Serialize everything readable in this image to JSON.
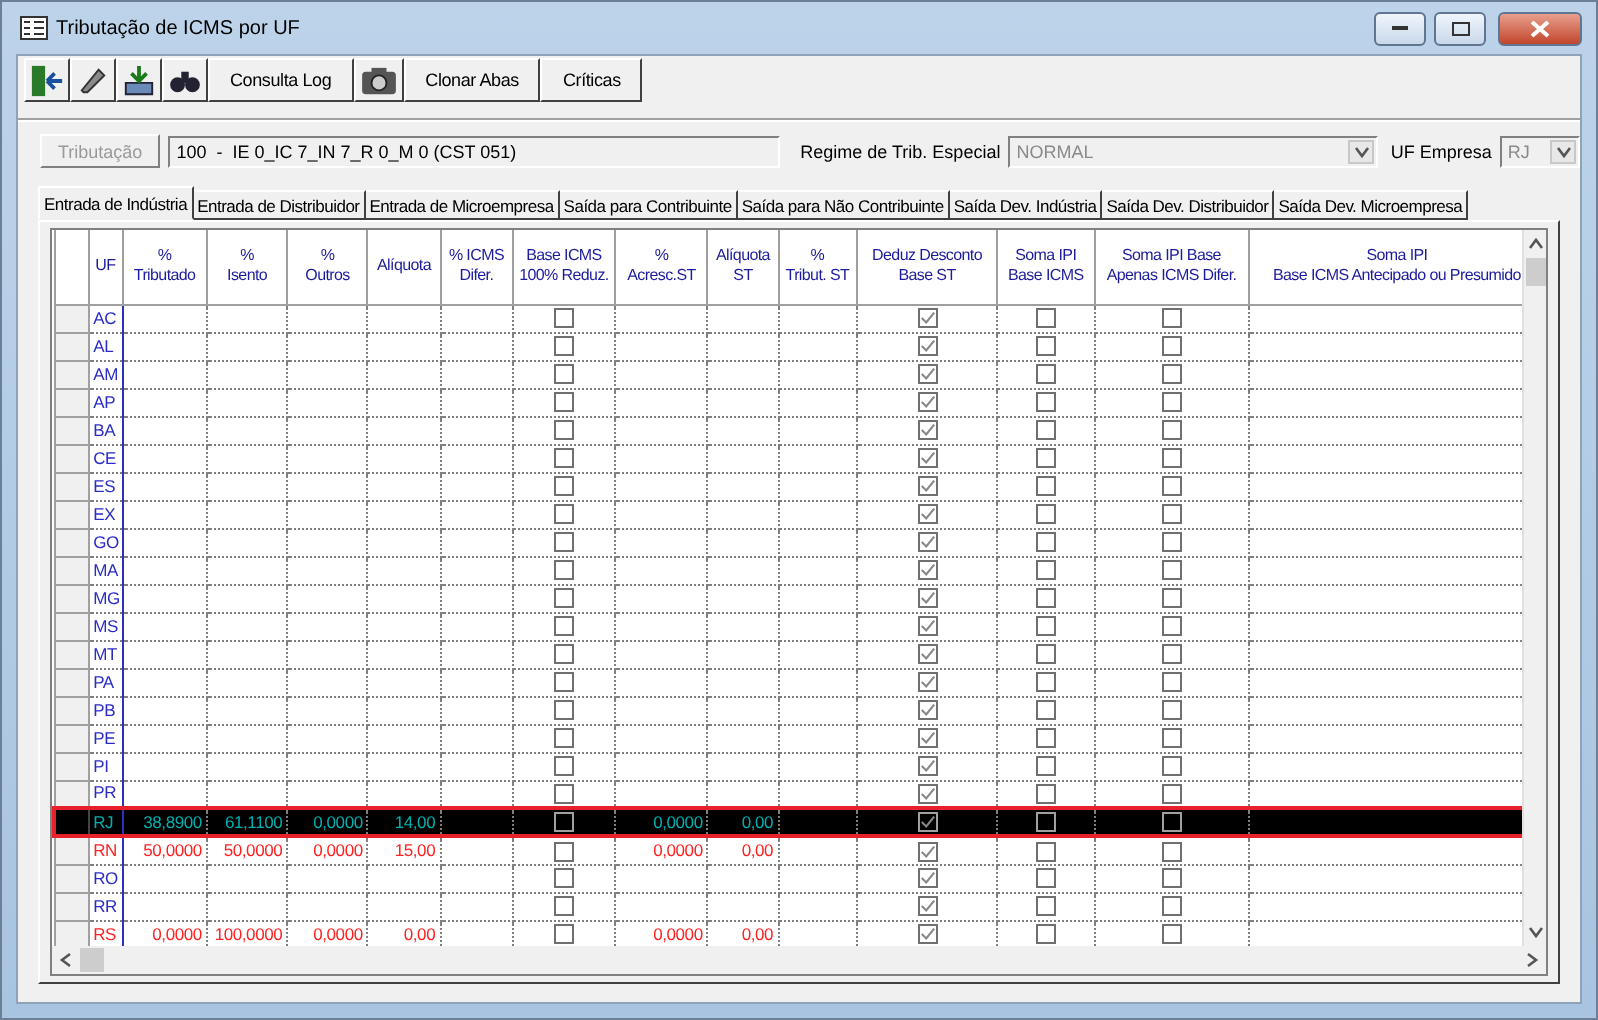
{
  "window": {
    "title": "Tributação de ICMS por UF"
  },
  "toolbar": {
    "buttons": [
      {
        "kind": "exit"
      },
      {
        "kind": "pencil"
      },
      {
        "kind": "import"
      },
      {
        "kind": "binoculars"
      },
      {
        "kind": "text",
        "label": "Consulta Log"
      },
      {
        "kind": "camera"
      },
      {
        "kind": "text",
        "label": "Clonar Abas"
      },
      {
        "kind": "text",
        "label": "Críticas"
      }
    ]
  },
  "tributacao": {
    "button": "Tributação",
    "disabled": true,
    "value": "100  -  IE 0_IC 7_IN 7_R 0_M 0 (CST 051)"
  },
  "regime": {
    "label": "Regime de Trib. Especial",
    "value": "NORMAL"
  },
  "uf_empresa": {
    "label": "UF Empresa",
    "value": "RJ"
  },
  "tabs": [
    {
      "label": "Entrada de Indústria",
      "selected": true
    },
    {
      "label": "Entrada de Distribuidor",
      "selected": false
    },
    {
      "label": "Entrada de Microempresa",
      "selected": false
    },
    {
      "label": "Saída para Contribuinte",
      "selected": false
    },
    {
      "label": "Saída para Não Contribuinte",
      "selected": false
    },
    {
      "label": "Saída Dev. Indústria",
      "selected": false
    },
    {
      "label": "Saída Dev. Distribuidor",
      "selected": false
    },
    {
      "label": "Saída Dev. Microempresa",
      "selected": false
    }
  ],
  "table": {
    "columns": [
      {
        "kind": "uf",
        "label": "UF"
      },
      {
        "kind": "num",
        "label": "%\nTributado"
      },
      {
        "kind": "num",
        "label": "%\nIsento"
      },
      {
        "kind": "num",
        "label": "%\nOutros"
      },
      {
        "kind": "num",
        "label": "Alíquota"
      },
      {
        "kind": "num",
        "label": "% ICMS\nDifer."
      },
      {
        "kind": "check",
        "label": "Base ICMS\n100% Reduz."
      },
      {
        "kind": "num",
        "label": "%\nAcresc.ST"
      },
      {
        "kind": "num",
        "label": "Alíquota\nST"
      },
      {
        "kind": "num",
        "label": "%\nTribut. ST"
      },
      {
        "kind": "check",
        "label": "Deduz Desconto\nBase ST"
      },
      {
        "kind": "check",
        "label": "Soma IPI\nBase ICMS"
      },
      {
        "kind": "check",
        "label": "Soma IPI Base\nApenas ICMS Difer."
      },
      {
        "kind": "num",
        "label": "Soma IPI\nBase ICMS Antecipado ou Presumido"
      }
    ],
    "rows": [
      {
        "color": "#2b2bc8",
        "selected": false,
        "cells": [
          "AC",
          "",
          "",
          "",
          "",
          "",
          false,
          "",
          "",
          "",
          true,
          false,
          false,
          ""
        ]
      },
      {
        "color": "#2b2bc8",
        "selected": false,
        "cells": [
          "AL",
          "",
          "",
          "",
          "",
          "",
          false,
          "",
          "",
          "",
          true,
          false,
          false,
          ""
        ]
      },
      {
        "color": "#2b2bc8",
        "selected": false,
        "cells": [
          "AM",
          "",
          "",
          "",
          "",
          "",
          false,
          "",
          "",
          "",
          true,
          false,
          false,
          ""
        ]
      },
      {
        "color": "#2b2bc8",
        "selected": false,
        "cells": [
          "AP",
          "",
          "",
          "",
          "",
          "",
          false,
          "",
          "",
          "",
          true,
          false,
          false,
          ""
        ]
      },
      {
        "color": "#2b2bc8",
        "selected": false,
        "cells": [
          "BA",
          "",
          "",
          "",
          "",
          "",
          false,
          "",
          "",
          "",
          true,
          false,
          false,
          ""
        ]
      },
      {
        "color": "#2b2bc8",
        "selected": false,
        "cells": [
          "CE",
          "",
          "",
          "",
          "",
          "",
          false,
          "",
          "",
          "",
          true,
          false,
          false,
          ""
        ]
      },
      {
        "color": "#2b2bc8",
        "selected": false,
        "cells": [
          "ES",
          "",
          "",
          "",
          "",
          "",
          false,
          "",
          "",
          "",
          true,
          false,
          false,
          ""
        ]
      },
      {
        "color": "#2b2bc8",
        "selected": false,
        "cells": [
          "EX",
          "",
          "",
          "",
          "",
          "",
          false,
          "",
          "",
          "",
          true,
          false,
          false,
          ""
        ]
      },
      {
        "color": "#2b2bc8",
        "selected": false,
        "cells": [
          "GO",
          "",
          "",
          "",
          "",
          "",
          false,
          "",
          "",
          "",
          true,
          false,
          false,
          ""
        ]
      },
      {
        "color": "#2b2bc8",
        "selected": false,
        "cells": [
          "MA",
          "",
          "",
          "",
          "",
          "",
          false,
          "",
          "",
          "",
          true,
          false,
          false,
          ""
        ]
      },
      {
        "color": "#2b2bc8",
        "selected": false,
        "cells": [
          "MG",
          "",
          "",
          "",
          "",
          "",
          false,
          "",
          "",
          "",
          true,
          false,
          false,
          ""
        ]
      },
      {
        "color": "#2b2bc8",
        "selected": false,
        "cells": [
          "MS",
          "",
          "",
          "",
          "",
          "",
          false,
          "",
          "",
          "",
          true,
          false,
          false,
          ""
        ]
      },
      {
        "color": "#2b2bc8",
        "selected": false,
        "cells": [
          "MT",
          "",
          "",
          "",
          "",
          "",
          false,
          "",
          "",
          "",
          true,
          false,
          false,
          ""
        ]
      },
      {
        "color": "#2b2bc8",
        "selected": false,
        "cells": [
          "PA",
          "",
          "",
          "",
          "",
          "",
          false,
          "",
          "",
          "",
          true,
          false,
          false,
          ""
        ]
      },
      {
        "color": "#2b2bc8",
        "selected": false,
        "cells": [
          "PB",
          "",
          "",
          "",
          "",
          "",
          false,
          "",
          "",
          "",
          true,
          false,
          false,
          ""
        ]
      },
      {
        "color": "#2b2bc8",
        "selected": false,
        "cells": [
          "PE",
          "",
          "",
          "",
          "",
          "",
          false,
          "",
          "",
          "",
          true,
          false,
          false,
          ""
        ]
      },
      {
        "color": "#2b2bc8",
        "selected": false,
        "cells": [
          "PI",
          "",
          "",
          "",
          "",
          "",
          false,
          "",
          "",
          "",
          true,
          false,
          false,
          ""
        ]
      },
      {
        "color": "#2b2bc8",
        "selected": false,
        "cells": [
          "PR",
          "",
          "",
          "",
          "",
          "",
          false,
          "",
          "",
          "",
          true,
          false,
          false,
          ""
        ]
      },
      {
        "color": "#00b0b0",
        "selected": true,
        "cells": [
          "RJ",
          "38,8900",
          "61,1100",
          "0,0000",
          "14,00",
          "",
          false,
          "0,0000",
          "0,00",
          "",
          true,
          false,
          false,
          ""
        ]
      },
      {
        "color": "#ff2020",
        "selected": false,
        "cells": [
          "RN",
          "50,0000",
          "50,0000",
          "0,0000",
          "15,00",
          "",
          false,
          "0,0000",
          "0,00",
          "",
          true,
          false,
          false,
          ""
        ]
      },
      {
        "color": "#2b2bc8",
        "selected": false,
        "cells": [
          "RO",
          "",
          "",
          "",
          "",
          "",
          false,
          "",
          "",
          "",
          true,
          false,
          false,
          ""
        ]
      },
      {
        "color": "#2b2bc8",
        "selected": false,
        "cells": [
          "RR",
          "",
          "",
          "",
          "",
          "",
          false,
          "",
          "",
          "",
          true,
          false,
          false,
          ""
        ]
      },
      {
        "color": "#ff2020",
        "selected": false,
        "cells": [
          "RS",
          "0,0000",
          "100,0000",
          "0,0000",
          "0,00",
          "",
          false,
          "0,0000",
          "0,00",
          "",
          true,
          false,
          false,
          ""
        ]
      }
    ]
  }
}
